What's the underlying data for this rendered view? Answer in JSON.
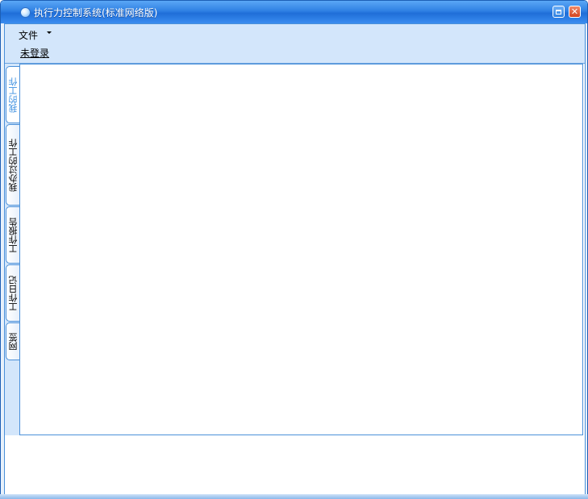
{
  "window": {
    "title": "执行力控制系统(标准网络版)"
  },
  "menubar": {
    "file_label": "文件",
    "login_label": "未登录"
  },
  "tabs": [
    {
      "label": "我的工作",
      "active": true
    },
    {
      "label": "我办过的工作",
      "active": false
    },
    {
      "label": "工作报告",
      "active": false
    },
    {
      "label": "工作日记",
      "active": false
    },
    {
      "label": "网签",
      "active": false
    }
  ],
  "colors": {
    "titlebar": "#2f80e3",
    "accent": "#3c8fe0",
    "panel": "#d3e6fb"
  }
}
